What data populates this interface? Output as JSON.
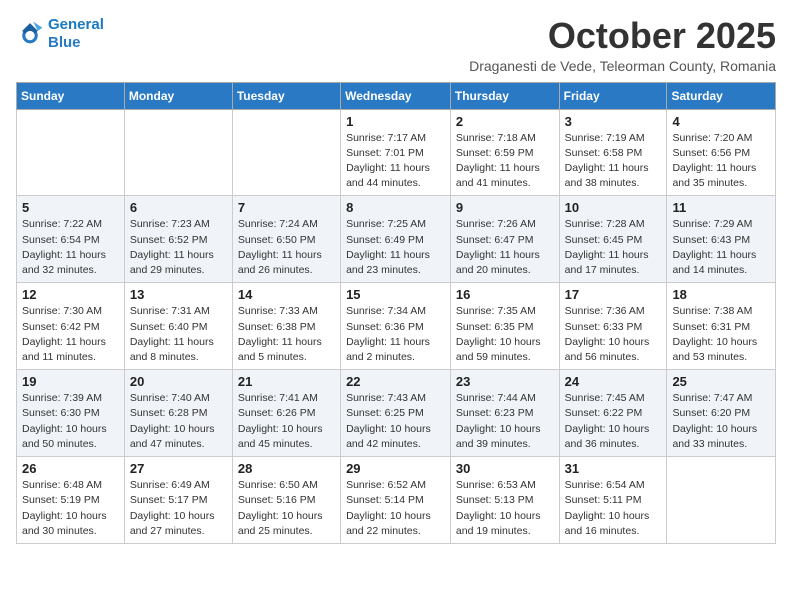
{
  "logo": {
    "line1": "General",
    "line2": "Blue"
  },
  "title": "October 2025",
  "subtitle": "Draganesti de Vede, Teleorman County, Romania",
  "days_of_week": [
    "Sunday",
    "Monday",
    "Tuesday",
    "Wednesday",
    "Thursday",
    "Friday",
    "Saturday"
  ],
  "weeks": [
    [
      {
        "day": "",
        "info": ""
      },
      {
        "day": "",
        "info": ""
      },
      {
        "day": "",
        "info": ""
      },
      {
        "day": "1",
        "info": "Sunrise: 7:17 AM\nSunset: 7:01 PM\nDaylight: 11 hours and 44 minutes."
      },
      {
        "day": "2",
        "info": "Sunrise: 7:18 AM\nSunset: 6:59 PM\nDaylight: 11 hours and 41 minutes."
      },
      {
        "day": "3",
        "info": "Sunrise: 7:19 AM\nSunset: 6:58 PM\nDaylight: 11 hours and 38 minutes."
      },
      {
        "day": "4",
        "info": "Sunrise: 7:20 AM\nSunset: 6:56 PM\nDaylight: 11 hours and 35 minutes."
      }
    ],
    [
      {
        "day": "5",
        "info": "Sunrise: 7:22 AM\nSunset: 6:54 PM\nDaylight: 11 hours and 32 minutes."
      },
      {
        "day": "6",
        "info": "Sunrise: 7:23 AM\nSunset: 6:52 PM\nDaylight: 11 hours and 29 minutes."
      },
      {
        "day": "7",
        "info": "Sunrise: 7:24 AM\nSunset: 6:50 PM\nDaylight: 11 hours and 26 minutes."
      },
      {
        "day": "8",
        "info": "Sunrise: 7:25 AM\nSunset: 6:49 PM\nDaylight: 11 hours and 23 minutes."
      },
      {
        "day": "9",
        "info": "Sunrise: 7:26 AM\nSunset: 6:47 PM\nDaylight: 11 hours and 20 minutes."
      },
      {
        "day": "10",
        "info": "Sunrise: 7:28 AM\nSunset: 6:45 PM\nDaylight: 11 hours and 17 minutes."
      },
      {
        "day": "11",
        "info": "Sunrise: 7:29 AM\nSunset: 6:43 PM\nDaylight: 11 hours and 14 minutes."
      }
    ],
    [
      {
        "day": "12",
        "info": "Sunrise: 7:30 AM\nSunset: 6:42 PM\nDaylight: 11 hours and 11 minutes."
      },
      {
        "day": "13",
        "info": "Sunrise: 7:31 AM\nSunset: 6:40 PM\nDaylight: 11 hours and 8 minutes."
      },
      {
        "day": "14",
        "info": "Sunrise: 7:33 AM\nSunset: 6:38 PM\nDaylight: 11 hours and 5 minutes."
      },
      {
        "day": "15",
        "info": "Sunrise: 7:34 AM\nSunset: 6:36 PM\nDaylight: 11 hours and 2 minutes."
      },
      {
        "day": "16",
        "info": "Sunrise: 7:35 AM\nSunset: 6:35 PM\nDaylight: 10 hours and 59 minutes."
      },
      {
        "day": "17",
        "info": "Sunrise: 7:36 AM\nSunset: 6:33 PM\nDaylight: 10 hours and 56 minutes."
      },
      {
        "day": "18",
        "info": "Sunrise: 7:38 AM\nSunset: 6:31 PM\nDaylight: 10 hours and 53 minutes."
      }
    ],
    [
      {
        "day": "19",
        "info": "Sunrise: 7:39 AM\nSunset: 6:30 PM\nDaylight: 10 hours and 50 minutes."
      },
      {
        "day": "20",
        "info": "Sunrise: 7:40 AM\nSunset: 6:28 PM\nDaylight: 10 hours and 47 minutes."
      },
      {
        "day": "21",
        "info": "Sunrise: 7:41 AM\nSunset: 6:26 PM\nDaylight: 10 hours and 45 minutes."
      },
      {
        "day": "22",
        "info": "Sunrise: 7:43 AM\nSunset: 6:25 PM\nDaylight: 10 hours and 42 minutes."
      },
      {
        "day": "23",
        "info": "Sunrise: 7:44 AM\nSunset: 6:23 PM\nDaylight: 10 hours and 39 minutes."
      },
      {
        "day": "24",
        "info": "Sunrise: 7:45 AM\nSunset: 6:22 PM\nDaylight: 10 hours and 36 minutes."
      },
      {
        "day": "25",
        "info": "Sunrise: 7:47 AM\nSunset: 6:20 PM\nDaylight: 10 hours and 33 minutes."
      }
    ],
    [
      {
        "day": "26",
        "info": "Sunrise: 6:48 AM\nSunset: 5:19 PM\nDaylight: 10 hours and 30 minutes."
      },
      {
        "day": "27",
        "info": "Sunrise: 6:49 AM\nSunset: 5:17 PM\nDaylight: 10 hours and 27 minutes."
      },
      {
        "day": "28",
        "info": "Sunrise: 6:50 AM\nSunset: 5:16 PM\nDaylight: 10 hours and 25 minutes."
      },
      {
        "day": "29",
        "info": "Sunrise: 6:52 AM\nSunset: 5:14 PM\nDaylight: 10 hours and 22 minutes."
      },
      {
        "day": "30",
        "info": "Sunrise: 6:53 AM\nSunset: 5:13 PM\nDaylight: 10 hours and 19 minutes."
      },
      {
        "day": "31",
        "info": "Sunrise: 6:54 AM\nSunset: 5:11 PM\nDaylight: 10 hours and 16 minutes."
      },
      {
        "day": "",
        "info": ""
      }
    ]
  ]
}
